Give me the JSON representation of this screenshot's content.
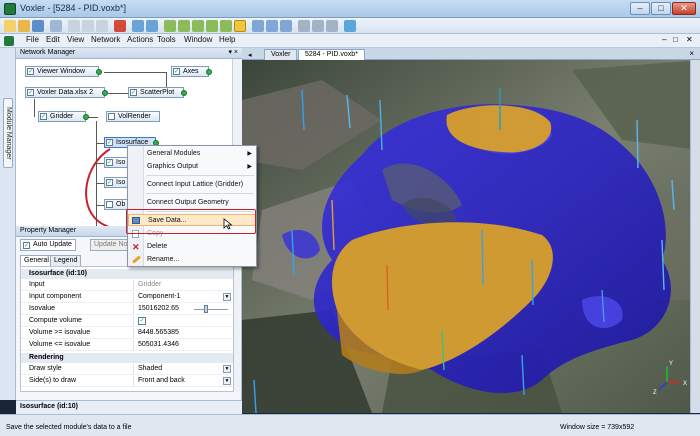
{
  "window": {
    "title": "Voxler - [5284 - PID.voxb*]",
    "min": "–",
    "max": "□",
    "close": "✕"
  },
  "menubar": {
    "items": [
      "File",
      "Edit",
      "View",
      "Network",
      "Actions",
      "Tools",
      "Window",
      "Help"
    ]
  },
  "module_manager_tab": "Module Manager",
  "network_manager": {
    "title": "Network Manager",
    "pin": "▾ ×",
    "nodes": {
      "viewer_window": "Viewer Window",
      "axes": "Axes",
      "voxler_data": "Voxler Data.xlsx 2",
      "scatterplot": "ScatterPlot",
      "gridder": "Gridder",
      "volrender": "VolRender",
      "isosurface": "Isosurface",
      "iso2": "Iso",
      "iso3": "Iso",
      "ob": "Ob"
    }
  },
  "property_manager": {
    "title": "Property Manager",
    "auto_update": "Auto Update",
    "update_now": "Update Now",
    "tabs": [
      "General",
      "Legend"
    ],
    "section_isosurface": "Isosurface (id:10)",
    "rows": [
      {
        "k": "Input",
        "v": "Gridder"
      },
      {
        "k": "Input component",
        "v": "Component-1"
      },
      {
        "k": "Isovalue",
        "v": "15016202.65"
      },
      {
        "k": "Compute volume",
        "v": "✓"
      },
      {
        "k": "Volume >= isovalue",
        "v": "8448.565385"
      },
      {
        "k": "Volume <= isovalue",
        "v": "505031.4346"
      }
    ],
    "section_rendering": "Rendering",
    "rendering_rows": [
      {
        "k": "Draw style",
        "v": "Shaded"
      },
      {
        "k": "Side(s) to draw",
        "v": "Front and back"
      }
    ],
    "footer": "Isosurface (id:10)"
  },
  "doc_tabs": {
    "tabs": [
      "Voxler",
      "5284 - PID.voxb*"
    ],
    "close": "×"
  },
  "context_menu": {
    "items": [
      {
        "label": "General Modules",
        "submenu": true
      },
      {
        "label": "Graphics Output",
        "submenu": true
      },
      {
        "label": "Connect Input Lattice (Gridder)",
        "submenu": false
      },
      {
        "label": "Connect Output Geometry",
        "submenu": false
      },
      {
        "label": "Save Data...",
        "submenu": false
      },
      {
        "label": "Copy",
        "submenu": false
      },
      {
        "label": "Delete",
        "submenu": false
      },
      {
        "label": "Rename...",
        "submenu": false
      }
    ],
    "arrow": "▶"
  },
  "statusbar": {
    "message": "Save the selected module's data to a file",
    "window_size": "Window size = 739x592"
  },
  "colors": {
    "accent": "#3a78c2",
    "highlight_outline": "#c8202a",
    "surface_blue": "#2a24c8",
    "surface_orange": "#d8a02a"
  }
}
